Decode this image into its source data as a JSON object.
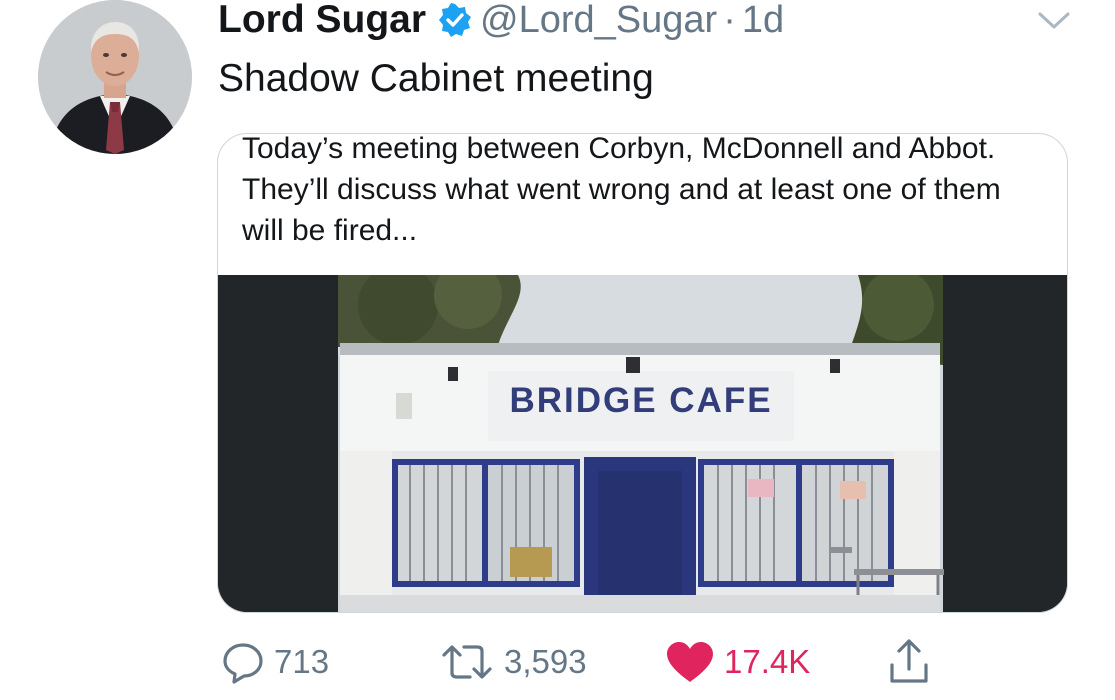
{
  "user": {
    "name": "Lord Sugar",
    "handle": "@Lord_Sugar",
    "separator": "·",
    "time": "1d"
  },
  "tweet": {
    "text": "Shadow Cabinet meeting"
  },
  "card": {
    "caption": "Today’s meeting between Corbyn, McDonnell and Abbot. They’ll discuss what went wrong and at least one of them will be fired...",
    "sign_text": "BRIDGE CAFE"
  },
  "actions": {
    "replies": "713",
    "retweets": "3,593",
    "likes": "17.4K"
  },
  "colors": {
    "verified": "#1da1f2",
    "like": "#e0245e",
    "secondary_text": "#657786",
    "sign_text": "#323d79"
  },
  "icons": [
    "verified-badge-icon",
    "caret-down-icon",
    "reply-icon",
    "retweet-icon",
    "heart-icon",
    "share-icon"
  ]
}
